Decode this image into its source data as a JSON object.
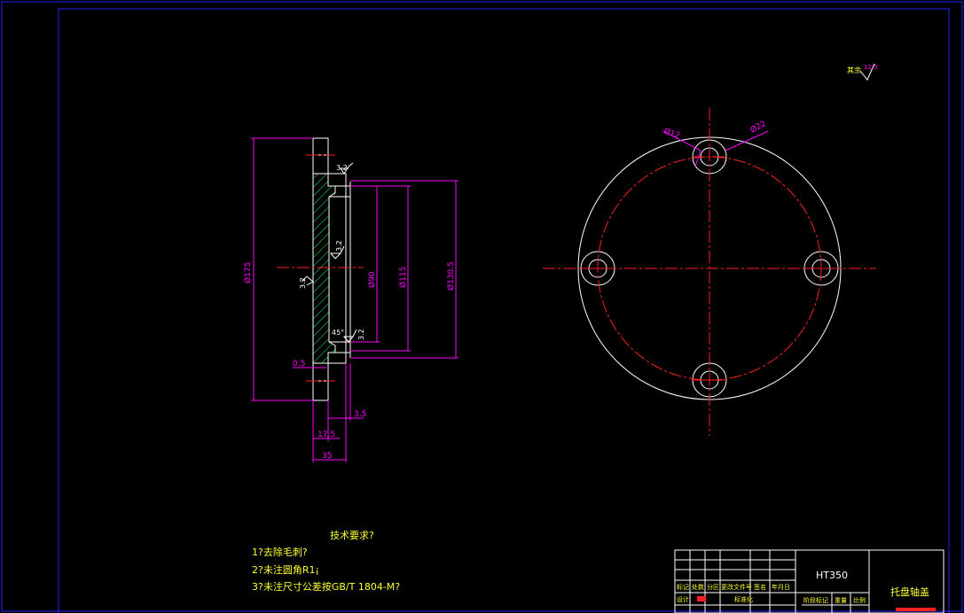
{
  "colors": {
    "background": "#000000",
    "border": "#2222ff",
    "outline": "#ffffff",
    "dimension": "#ff00ff",
    "centerline": "#ff2020",
    "hatch": "#00ff66",
    "text": "#ffff33"
  },
  "section_view": {
    "diameters": [
      "Ø175",
      "Ø90",
      "Ø115",
      "Ø130.5"
    ],
    "widths": [
      "17.5",
      "35",
      "3.5",
      "0.5"
    ],
    "roughness": [
      "3.2",
      "3.2",
      "3.2",
      "3.2"
    ],
    "chamfer": "45°"
  },
  "plan_view": {
    "hole_label": "Ø12",
    "counterbore_label": "Ø22"
  },
  "surface_note": {
    "label": "其余",
    "value": "12.5"
  },
  "tech_requirements": {
    "title": "技术要求?",
    "items": [
      "1?去除毛刺?",
      "2?未注圆角R1¡",
      "3?未注尺寸公差按GB/T 1804-M?"
    ]
  },
  "title_block": {
    "material": "HT350",
    "part_name": "托盘轴盖",
    "row_labels": [
      "标记",
      "处数",
      "分区",
      "更改文件号",
      "签名",
      "年月日"
    ],
    "design_label": "设计",
    "standard_label": "标准化",
    "stage_label": "阶段标记",
    "weight_label": "重量",
    "scale_label": "比例"
  }
}
